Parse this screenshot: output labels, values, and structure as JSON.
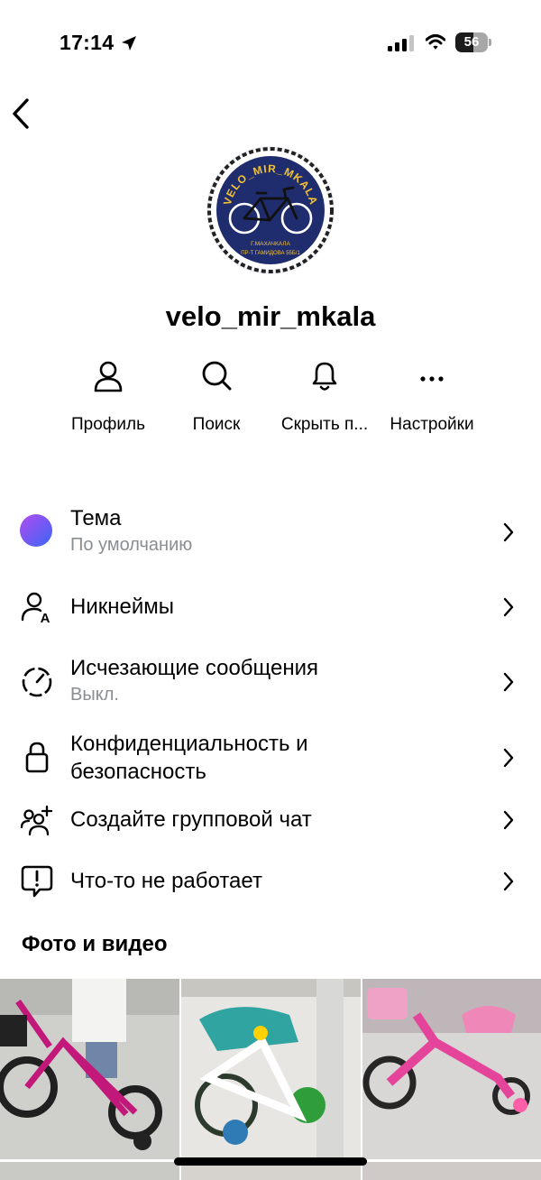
{
  "status_bar": {
    "time": "17:14",
    "battery": "56",
    "battery_level": 0.56
  },
  "profile": {
    "username": "velo_mir_mkala",
    "logo_text_top": "VELO_MIR_MKALA",
    "logo_text_city": "Г.МАХАЧКАЛА",
    "logo_text_address": "ПР-Т ГАМИДОВА 55Б/1"
  },
  "actions": [
    {
      "label": "Профиль",
      "icon": "person-icon"
    },
    {
      "label": "Поиск",
      "icon": "search-icon"
    },
    {
      "label": "Скрыть п...",
      "icon": "bell-icon"
    },
    {
      "label": "Настройки",
      "icon": "more-icon"
    }
  ],
  "menu": [
    {
      "title": "Тема",
      "subtitle": "По умолчанию",
      "icon": "theme-gradient-circle"
    },
    {
      "title": "Никнеймы",
      "subtitle": "",
      "icon": "nickname-icon"
    },
    {
      "title": "Исчезающие сообщения",
      "subtitle": "Выкл.",
      "icon": "timer-icon"
    },
    {
      "title_line1": "Конфиденциальность и",
      "title_line2": "безопасность",
      "icon": "lock-icon"
    },
    {
      "title": "Создайте групповой чат",
      "subtitle": "",
      "icon": "add-group-icon"
    },
    {
      "title": "Что-то не работает",
      "subtitle": "",
      "icon": "report-icon"
    }
  ],
  "media_section": {
    "title": "Фото и видео"
  },
  "colors": {
    "theme_gradient_start": "#a94cf0",
    "theme_gradient_end": "#3f63f5",
    "secondary_text": "#8a8d91",
    "logo_navy": "#1f2c6e",
    "logo_yellow": "#f3c233"
  }
}
